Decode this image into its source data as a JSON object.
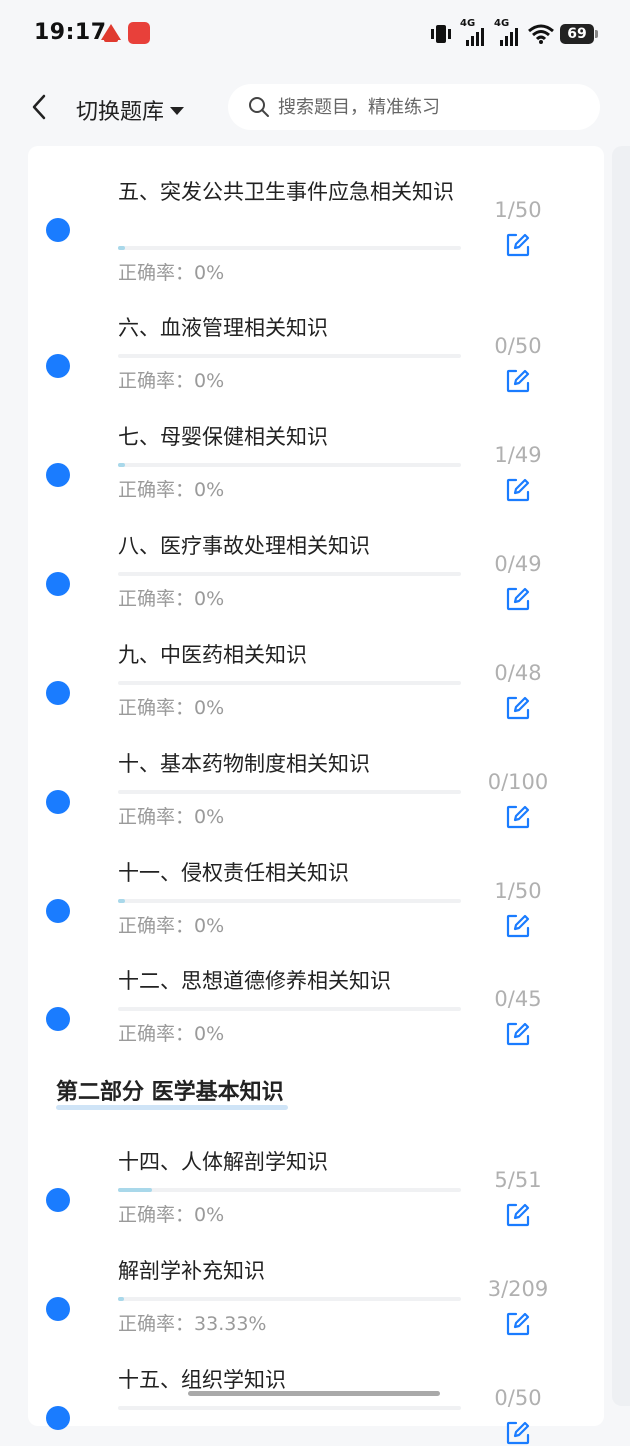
{
  "status": {
    "time": "19:17",
    "net1": "4G",
    "net2": "4G",
    "battery": "69"
  },
  "header": {
    "switch_label": "切换题库",
    "search_placeholder": "搜索题目，精准练习"
  },
  "accuracy_label": "正确率：",
  "colors": {
    "dot": "#1a7cff",
    "progress": "#a9d8ea",
    "edit": "#1a7cff"
  },
  "section": {
    "title": "第二部分 医学基本知识"
  },
  "items": [
    {
      "title": "五、突发公共卫生事件应急相关知识",
      "accuracy": "0%",
      "count": "1/50",
      "progress": 0.02
    },
    {
      "title": "六、血液管理相关知识",
      "accuracy": "0%",
      "count": "0/50",
      "progress": 0
    },
    {
      "title": "七、母婴保健相关知识",
      "accuracy": "0%",
      "count": "1/49",
      "progress": 0.02
    },
    {
      "title": "八、医疗事故处理相关知识",
      "accuracy": "0%",
      "count": "0/49",
      "progress": 0
    },
    {
      "title": "九、中医药相关知识",
      "accuracy": "0%",
      "count": "0/48",
      "progress": 0
    },
    {
      "title": "十、基本药物制度相关知识",
      "accuracy": "0%",
      "count": "0/100",
      "progress": 0
    },
    {
      "title": "十一、侵权责任相关知识",
      "accuracy": "0%",
      "count": "1/50",
      "progress": 0.02
    },
    {
      "title": "十二、思想道德修养相关知识",
      "accuracy": "0%",
      "count": "0/45",
      "progress": 0
    },
    {
      "title": "十四、人体解剖学知识",
      "accuracy": "0%",
      "count": "5/51",
      "progress": 0.098
    },
    {
      "title": "解剖学补充知识",
      "accuracy": "33.33%",
      "count": "3/209",
      "progress": 0.014
    },
    {
      "title": "十五、组织学知识",
      "accuracy": "",
      "count": "0/50",
      "progress": 0
    }
  ]
}
